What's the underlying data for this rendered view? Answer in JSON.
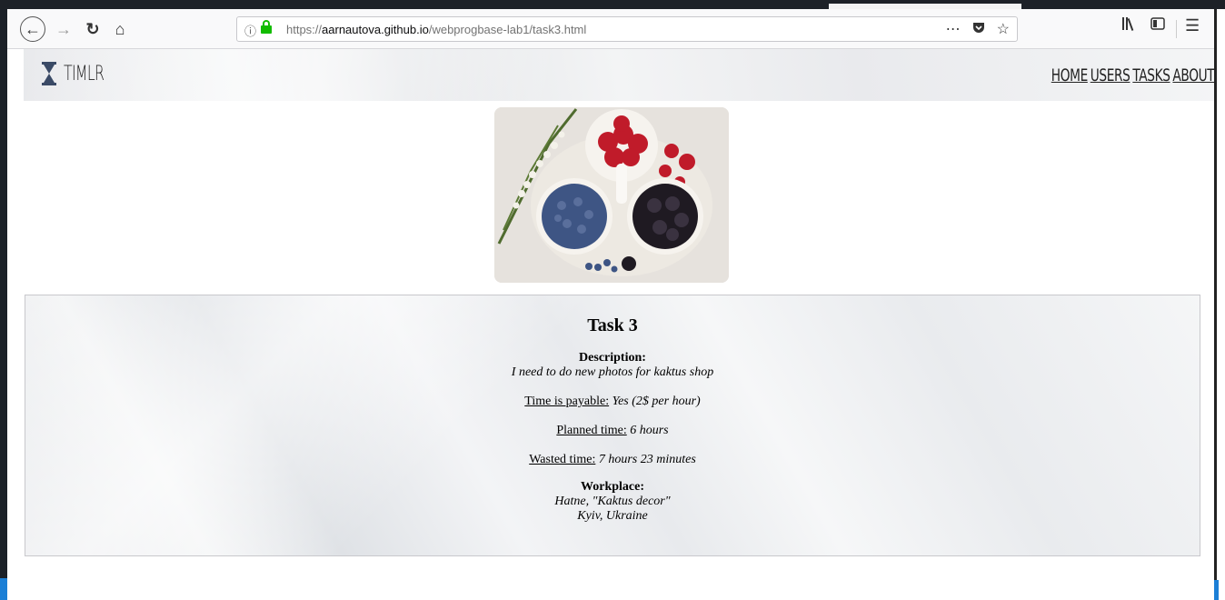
{
  "browser": {
    "url_prefix": "https://",
    "url_host": "aarnautova.github.io",
    "url_path": "/webprogbase-lab1/task3.html",
    "icons": [
      "back-icon",
      "forward-icon",
      "reload-icon",
      "home-icon",
      "info-icon",
      "lock-icon",
      "more-icon",
      "pocket-icon",
      "bookmark-star-icon",
      "library-icon",
      "sidebar-icon",
      "menu-icon"
    ]
  },
  "site": {
    "logo_text": "TIMLR",
    "nav": [
      "HOME",
      "USERS",
      "TASKS",
      "ABOUT"
    ]
  },
  "task": {
    "title": "Task 3",
    "description_label": "Description:",
    "description": "I need to do new photos for kaktus shop",
    "payable_label": "Time is payable:",
    "payable_value": "Yes (2$ per hour)",
    "planned_label": "Planned time:",
    "planned_value": "6 hours",
    "wasted_label": "Wasted time:",
    "wasted_value": "7 hours 23 minutes",
    "workplace_label": "Workplace:",
    "workplace_line1": "Hatne, \"Kaktus decor\"",
    "workplace_line2": "Kyiv, Ukraine"
  },
  "colors": {
    "lock": "#12bc00",
    "logo": "#3a4a66",
    "taskbar_accent": "#1c7fd6"
  }
}
